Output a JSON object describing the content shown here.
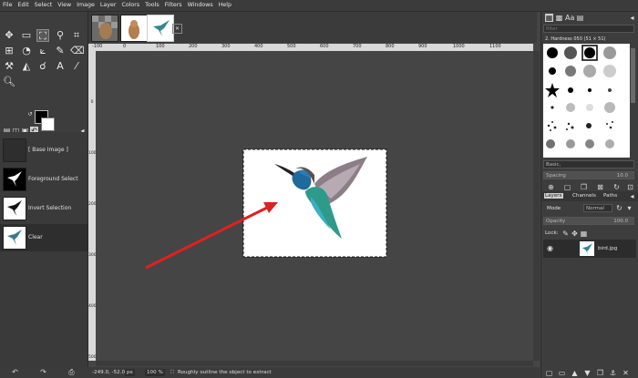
{
  "menu": [
    "File",
    "Edit",
    "Select",
    "View",
    "Image",
    "Layer",
    "Colors",
    "Tools",
    "Filters",
    "Windows",
    "Help"
  ],
  "history": {
    "items": [
      {
        "label": "[ Base Image ]",
        "thumb": "dark"
      },
      {
        "label": "Foreground Select",
        "thumb": "bird"
      },
      {
        "label": "Invert Selection",
        "thumb": "bird"
      },
      {
        "label": "Clear",
        "thumb": "bird",
        "selected": true
      }
    ]
  },
  "ruler": {
    "h_labels": [
      "-100",
      "0",
      "100",
      "200",
      "300",
      "400",
      "500",
      "600",
      "700",
      "800",
      "900",
      "1000",
      "1100"
    ],
    "v_labels": [
      "0",
      "100",
      "200",
      "300",
      "400",
      "500"
    ]
  },
  "status": {
    "coords": "-249.0, -52.0",
    "unit": "px",
    "zoom": "100 %",
    "message": "Roughly outline the object to extract"
  },
  "brushes": {
    "filter_placeholder": "filter",
    "title": "2. Hardness 050 (51 × 51)",
    "preset": "Basic,",
    "spacing_label": "Spacing",
    "spacing_value": "10.0"
  },
  "layers": {
    "tabs": [
      "Layers",
      "Channels",
      "Paths"
    ],
    "mode_label": "Mode",
    "mode_value": "Normal",
    "opacity_label": "Opacity",
    "opacity_value": "100.0",
    "lock_label": "Lock:",
    "items": [
      {
        "name": "bird.jpg"
      }
    ]
  },
  "colors": {
    "accent_arrow": "#e02020",
    "canvas_bg": "#454545"
  }
}
